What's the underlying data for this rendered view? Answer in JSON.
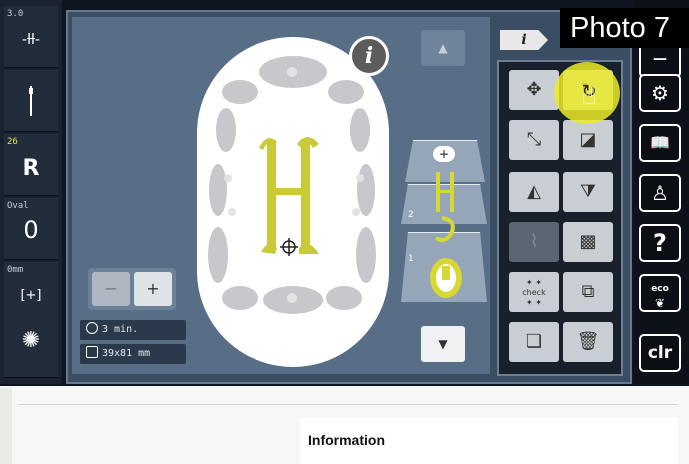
{
  "photo_label": "Photo 7",
  "left_sidebar": {
    "items": [
      {
        "label": "3.0",
        "icon": "stitch-width-icon",
        "glyph": "-ƚƚ-"
      },
      {
        "label": "",
        "icon": "needle-icon",
        "glyph": "|"
      },
      {
        "label": "26",
        "icon": "presser-foot-icon",
        "glyph": "R"
      },
      {
        "label": "Oval",
        "icon": "hoop-icon",
        "glyph": "0"
      },
      {
        "label": "0mm",
        "icon": "stitch-plate-icon",
        "glyph": "[+]"
      },
      {
        "label": "",
        "icon": "bobbin-icon",
        "glyph": "✺"
      }
    ]
  },
  "canvas": {
    "info_label": "i",
    "zoom_out_label": "−",
    "zoom_in_label": "+",
    "stitch_time": "3 min.",
    "design_size": "39x81 mm",
    "scroll_up_glyph": "▲",
    "scroll_down_glyph": "▼",
    "layers": [
      {
        "num": "2"
      },
      {
        "num": "1"
      }
    ],
    "add_layer_glyph": "+"
  },
  "tool_panel": {
    "tab_label": "i",
    "check_label": "check",
    "tools": [
      {
        "name": "move-tool",
        "glyph": "✥"
      },
      {
        "name": "rotate-tool",
        "glyph": "↻"
      },
      {
        "name": "resize-tool",
        "glyph": "⤡"
      },
      {
        "name": "shape-tool",
        "glyph": "◪"
      },
      {
        "name": "mirror-vertical-tool",
        "glyph": "◭"
      },
      {
        "name": "mirror-horizontal-tool",
        "glyph": "⧩"
      },
      {
        "name": "lettering-tool",
        "glyph": "⌇"
      },
      {
        "name": "fill-pattern-tool",
        "glyph": "▩"
      },
      {
        "name": "check-tool",
        "glyph": "check"
      },
      {
        "name": "duplicate-tool",
        "glyph": "⧉"
      },
      {
        "name": "layers-tool",
        "glyph": "❏"
      },
      {
        "name": "delete-tool",
        "glyph": "🗑"
      }
    ]
  },
  "right_sidebar": {
    "buttons": [
      {
        "label": "—",
        "icon": "home-icon"
      },
      {
        "label": "⚙",
        "icon": "settings-icon"
      },
      {
        "label": "📖",
        "icon": "guide-icon"
      },
      {
        "label": "♙",
        "icon": "mannequin-icon"
      },
      {
        "label": "?",
        "icon": "help-icon"
      },
      {
        "label": "eco",
        "icon": "eco-icon"
      },
      {
        "label": "clr",
        "icon": "clear-icon"
      }
    ]
  },
  "document": {
    "heading": "Information"
  },
  "colors": {
    "embroidery_yellow": "#c9c93a",
    "highlight": "#ebeb28"
  }
}
